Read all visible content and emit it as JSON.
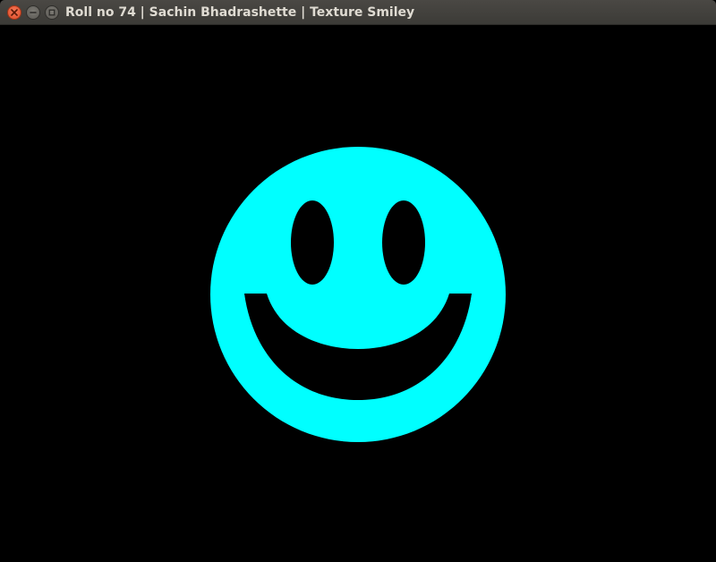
{
  "window": {
    "title": "Roll no 74 | Sachin Bhadrashette | Texture Smiley",
    "controls": [
      "close",
      "minimize",
      "maximize"
    ]
  },
  "scene": {
    "background_color": "#000000",
    "smiley_color": "#00FFFF",
    "features_color": "#000000",
    "icon": "smiley-face-icon"
  }
}
